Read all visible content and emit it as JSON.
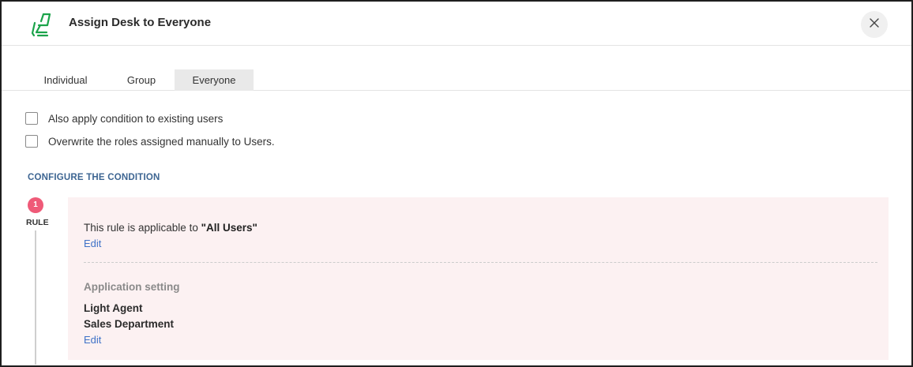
{
  "header": {
    "title": "Assign Desk to Everyone",
    "icon": "desk-chair-icon",
    "icon_color": "#1ba34a",
    "close_icon": "close-icon"
  },
  "tabs": [
    {
      "label": "Individual",
      "selected": false
    },
    {
      "label": "Group",
      "selected": false
    },
    {
      "label": "Everyone",
      "selected": true
    }
  ],
  "options": [
    {
      "label": "Also apply condition to existing users",
      "checked": false
    },
    {
      "label": "Overwrite the roles assigned manually to Users.",
      "checked": false
    }
  ],
  "section": {
    "heading": "CONFIGURE THE CONDITION"
  },
  "rule": {
    "step_number": "1",
    "step_label": "RULE",
    "applicable_prefix": "This rule is applicable to",
    "applicable_value": "\"All Users\"",
    "edit_label": "Edit",
    "setting_heading": "Application setting",
    "settings": [
      "Light Agent",
      "Sales Department"
    ],
    "setting_edit_label": "Edit",
    "step_color": "#ef5a78",
    "box_color": "#fcf1f2",
    "link_color": "#3f72c7"
  }
}
